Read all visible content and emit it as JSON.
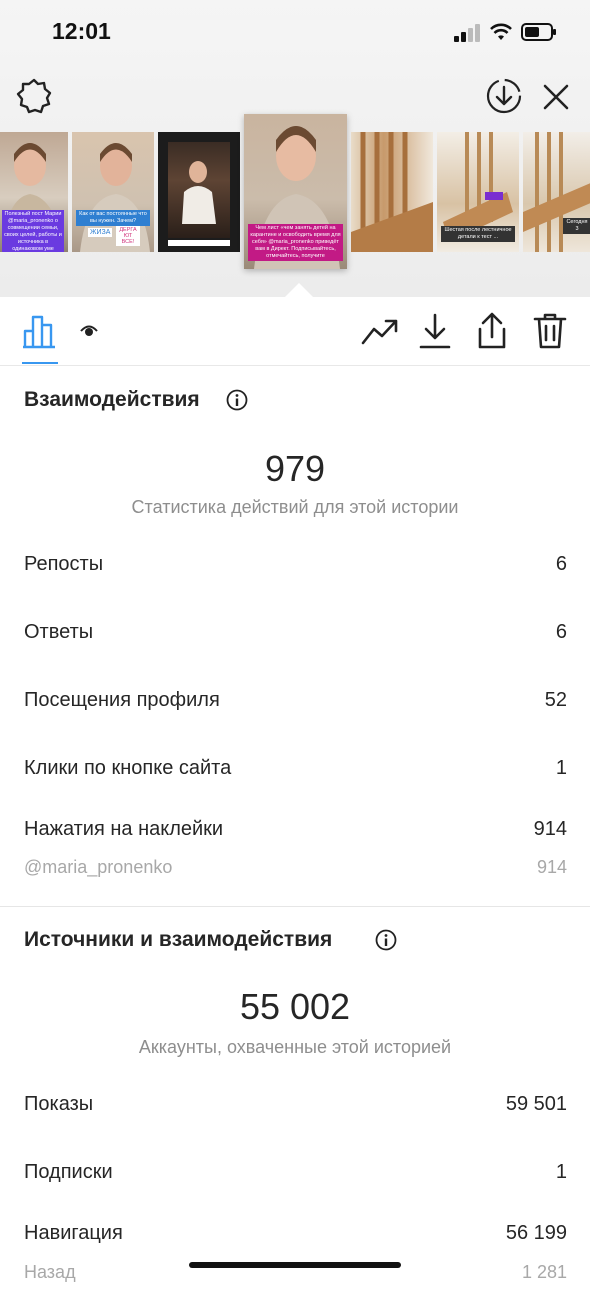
{
  "status_bar": {
    "time": "12:01"
  },
  "thumbnails": [
    {
      "name": "story-thumb-1",
      "caption": "Полезный пост Марии @maria_pronenko о совмещении семьи, своих целей, работы и источника в одинаковом уме"
    },
    {
      "name": "story-thumb-2",
      "caption": "Как от вас постоянные что вы нужен. Зачем?",
      "stickers": [
        "ЖИЗА",
        "ДЕРГА ЮТ ВСЕ!"
      ]
    },
    {
      "name": "story-thumb-3",
      "caption": ""
    },
    {
      "name": "story-thumb-4-selected",
      "caption": "Чем лист «чем занять детей на карантине и освободить время для себя» @maria_pronenko приведёт вам в Директ. Подписывайтесь, отмечайтесь, получите"
    },
    {
      "name": "story-thumb-5",
      "caption": ""
    },
    {
      "name": "story-thumb-6",
      "caption": "Шестая после лестничное детали к тест ..."
    },
    {
      "name": "story-thumb-7",
      "caption": "Сегодня 3"
    }
  ],
  "interactions": {
    "title": "Взаимодействия",
    "total": "979",
    "subtitle": "Статистика действий для этой истории",
    "rows": [
      {
        "label": "Репосты",
        "value": "6"
      },
      {
        "label": "Ответы",
        "value": "6"
      },
      {
        "label": "Посещения профиля",
        "value": "52"
      },
      {
        "label": "Клики по кнопке сайта",
        "value": "1"
      },
      {
        "label": "Нажатия на наклейки",
        "value": "914"
      }
    ],
    "sticker_row": {
      "label": "@maria_pronenko",
      "value": "914"
    }
  },
  "discovery": {
    "title": "Источники и взаимодействия",
    "total": "55 002",
    "subtitle": "Аккаунты, охваченные этой историей",
    "rows": [
      {
        "label": "Показы",
        "value": "59 501"
      },
      {
        "label": "Подписки",
        "value": "1"
      },
      {
        "label": "Навигация",
        "value": "56 199"
      }
    ],
    "back_row": {
      "label": "Назад",
      "value": "1 281"
    }
  },
  "colors": {
    "accent": "#3897f0",
    "text": "#262626",
    "muted": "#8e8e8e"
  }
}
